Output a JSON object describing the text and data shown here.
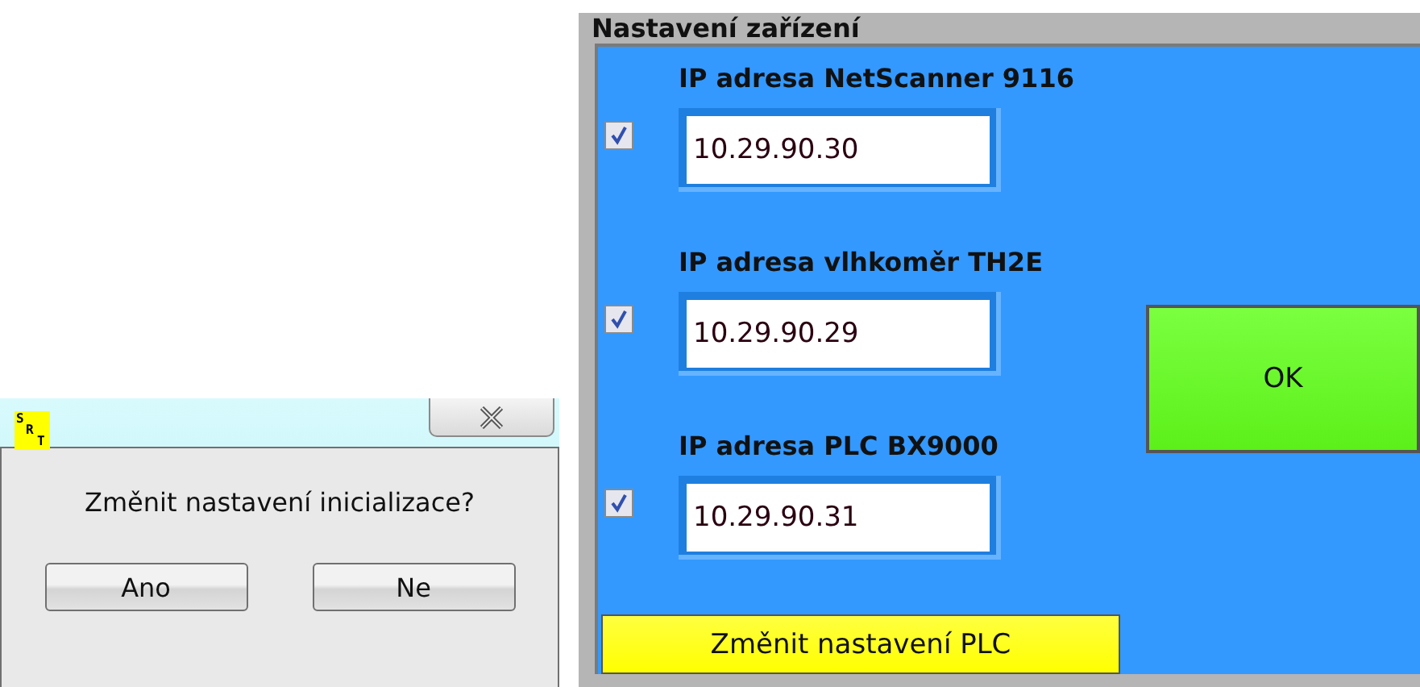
{
  "dialog": {
    "logo_letters": [
      "S",
      "R",
      "T"
    ],
    "message": "Změnit nastavení inicializace?",
    "buttons": [
      "Ano",
      "Ne"
    ]
  },
  "panel": {
    "title": "Nastavení zařízení",
    "devices": [
      {
        "label": "IP adresa NetScanner 9116",
        "value": "10.29.90.30",
        "checked": true
      },
      {
        "label": "IP adresa vlhkoměr TH2E",
        "value": "10.29.90.29",
        "checked": true
      },
      {
        "label": "IP adresa PLC BX9000",
        "value": "10.29.90.31",
        "checked": true
      }
    ],
    "ok_button": "OK",
    "plc_button": "Změnit nastavení PLC"
  }
}
